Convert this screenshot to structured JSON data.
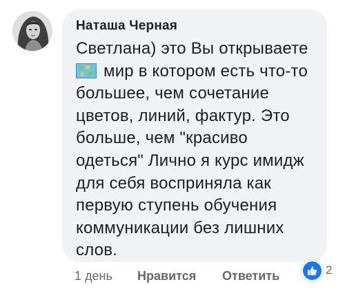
{
  "comment": {
    "author_name": "Наташа Черная",
    "text_line1": "Светлана) это Вы открываете",
    "emoji_icon": "world-map-icon",
    "text_after_emoji": "мир в котором есть что-то большее, чем сочетание цветов, линий, фактур. Это больше, чем \"красиво одеться\" Лично я курс имидж для себя восприняла как первую ступень обучения коммуникации без лишних слов.",
    "bubble_color": "#f0f2f5"
  },
  "reactions": {
    "icon": "like-icon",
    "count": "2",
    "color": "#1877f2"
  },
  "actions": {
    "time": "1 день",
    "like_label": "Нравится",
    "reply_label": "Ответить"
  }
}
